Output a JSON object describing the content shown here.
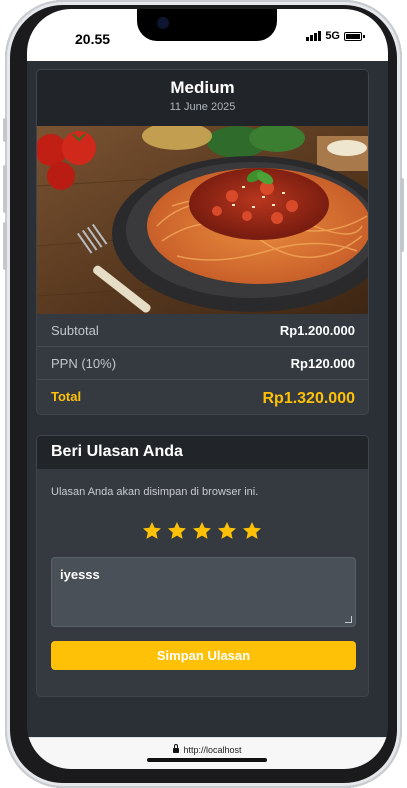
{
  "status_bar": {
    "time": "20.55",
    "network": "5G"
  },
  "order": {
    "title": "Medium",
    "date": "11 June 2025",
    "image_alt": "spaghetti-bolognese",
    "rows": [
      {
        "label": "Subtotal",
        "value": "Rp1.200.000"
      },
      {
        "label": "PPN (10%)",
        "value": "Rp120.000"
      }
    ],
    "total": {
      "label": "Total",
      "value": "Rp1.320.000"
    }
  },
  "review": {
    "heading": "Beri Ulasan Anda",
    "note": "Ulasan Anda akan disimpan di browser ini.",
    "rating": 5,
    "max_rating": 5,
    "text": "iyesss",
    "submit_label": "Simpan Ulasan"
  },
  "browser": {
    "url": "http://localhost"
  },
  "colors": {
    "accent": "#ffc107",
    "card": "#343a40",
    "header": "#212529",
    "page": "#2b2f36"
  }
}
